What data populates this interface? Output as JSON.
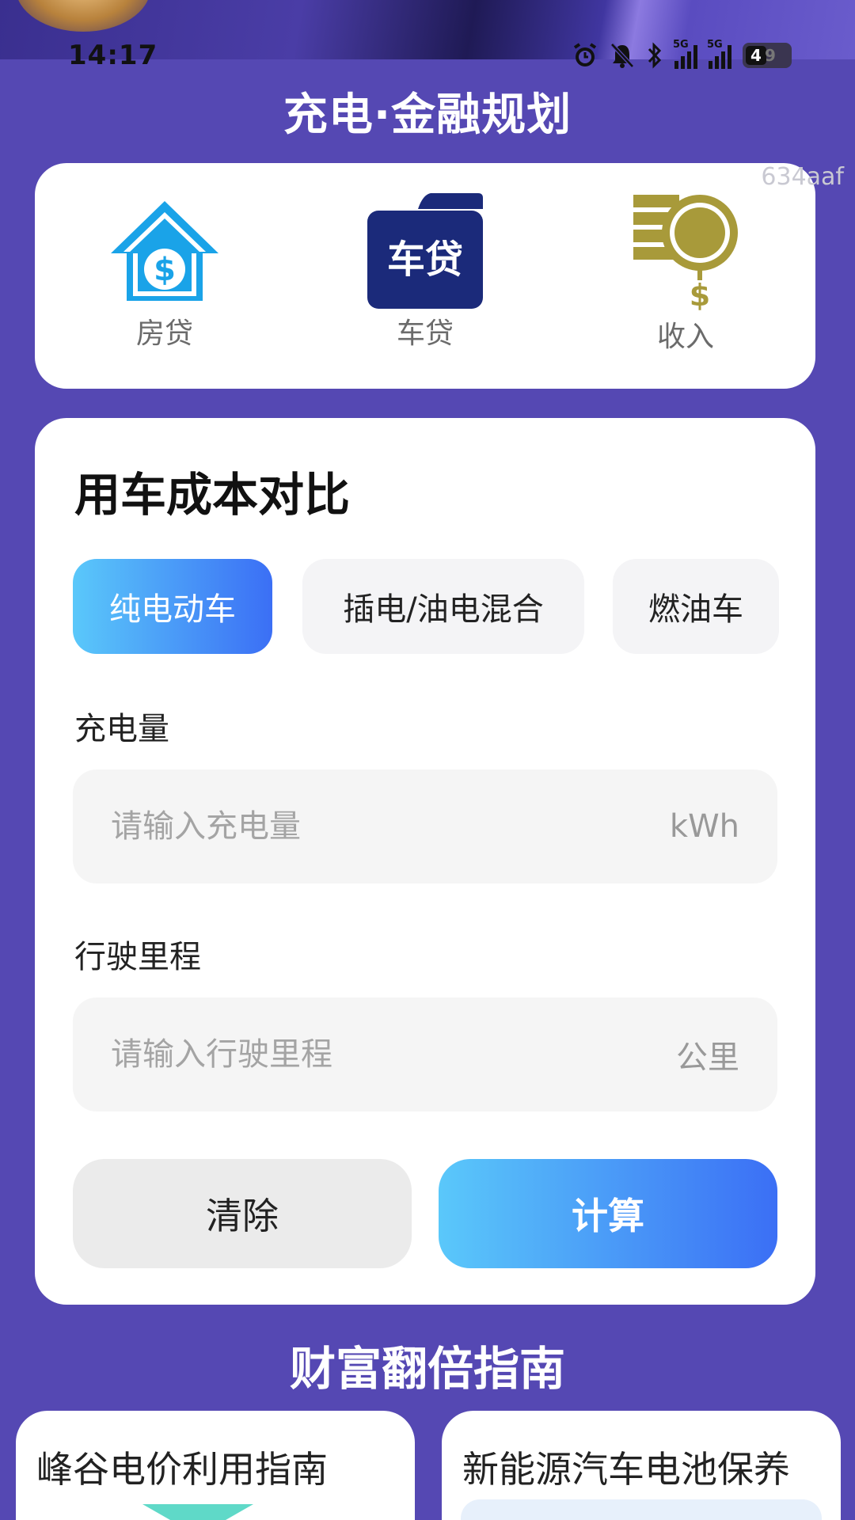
{
  "status": {
    "time": "14:17",
    "network1": "5G",
    "network2": "5G",
    "battery": "49"
  },
  "app": {
    "title": "充电·金融规划"
  },
  "icons": {
    "watermark": "634aaf",
    "items": [
      {
        "label": "房贷",
        "icon": "house-dollar-icon"
      },
      {
        "label": "车贷",
        "icon": "car-loan-icon",
        "badge_text": "车贷"
      },
      {
        "label": "收入",
        "icon": "coins-dollar-icon"
      }
    ]
  },
  "cost": {
    "title": "用车成本对比",
    "tabs": [
      {
        "label": "纯电动车",
        "active": true
      },
      {
        "label": "插电/油电混合",
        "active": false
      },
      {
        "label": "燃油车",
        "active": false
      }
    ],
    "fields": [
      {
        "label": "充电量",
        "placeholder": "请输入充电量",
        "value": "",
        "unit": "kWh"
      },
      {
        "label": "行驶里程",
        "placeholder": "请输入行驶里程",
        "value": "",
        "unit": "公里"
      }
    ],
    "clear_label": "清除",
    "calc_label": "计算"
  },
  "guide": {
    "title": "财富翻倍指南",
    "cards": [
      {
        "title": "峰谷电价利用指南"
      },
      {
        "title": "新能源汽车电池保养"
      }
    ]
  },
  "colors": {
    "background": "#5548b3",
    "accent_start": "#5ac8fa",
    "accent_end": "#3b6ff5",
    "house_icon": "#1aa3e8",
    "car_loan_icon": "#1b2a7a",
    "coin_icon": "#a89a3a"
  }
}
